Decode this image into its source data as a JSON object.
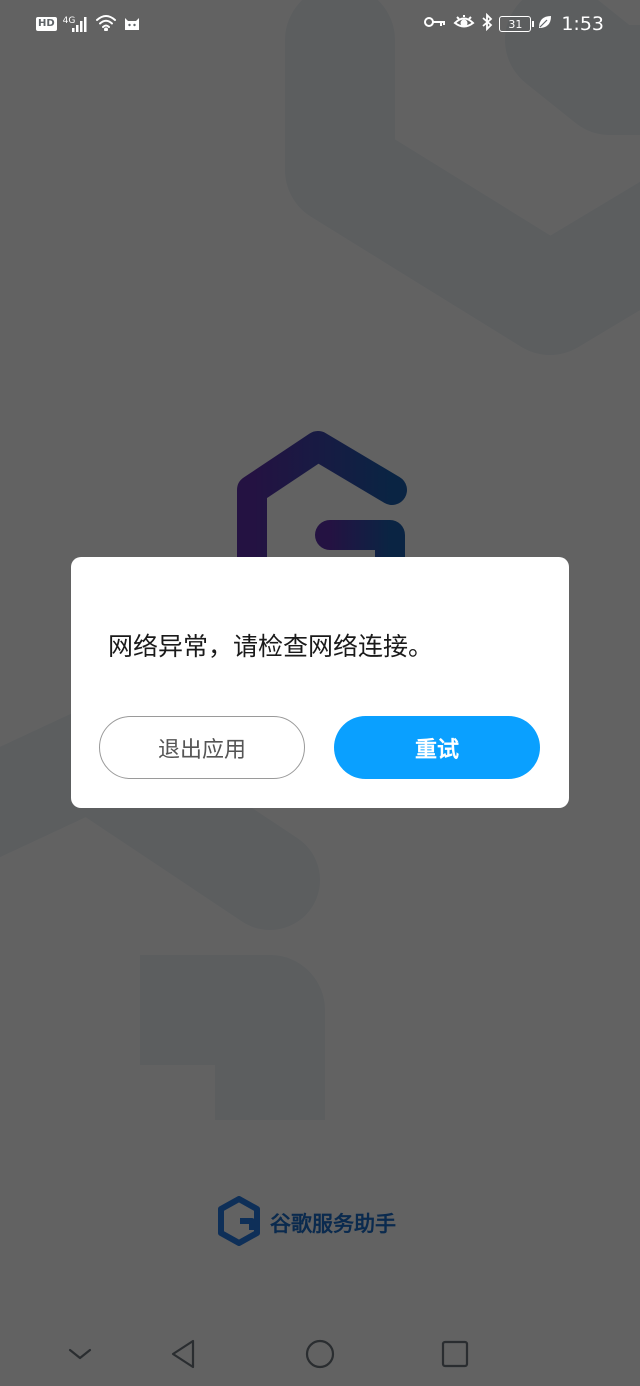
{
  "status_bar": {
    "hd_badge": "HD",
    "network": "4G",
    "battery_level": "31",
    "time": "1:53",
    "icons": [
      "signal-icon",
      "wifi-icon",
      "cat-icon",
      "key-icon",
      "eye-icon",
      "bluetooth-icon",
      "battery-icon",
      "leaf-icon"
    ]
  },
  "dialog": {
    "message": "网络异常，请检查网络连接。",
    "exit_label": "退出应用",
    "retry_label": "重试"
  },
  "brand": {
    "name": "谷歌服务助手",
    "logo_icon": "hexagon-g-logo-icon"
  },
  "nav_bar": {
    "icons": [
      "chevron-down-icon",
      "back-triangle-icon",
      "home-circle-icon",
      "recents-square-icon"
    ]
  },
  "colors": {
    "accent": "#0aa0ff",
    "brand_text": "#0d4a8c",
    "logo_blue": "#1a4e94",
    "logo_purple": "#4a2a8c"
  }
}
